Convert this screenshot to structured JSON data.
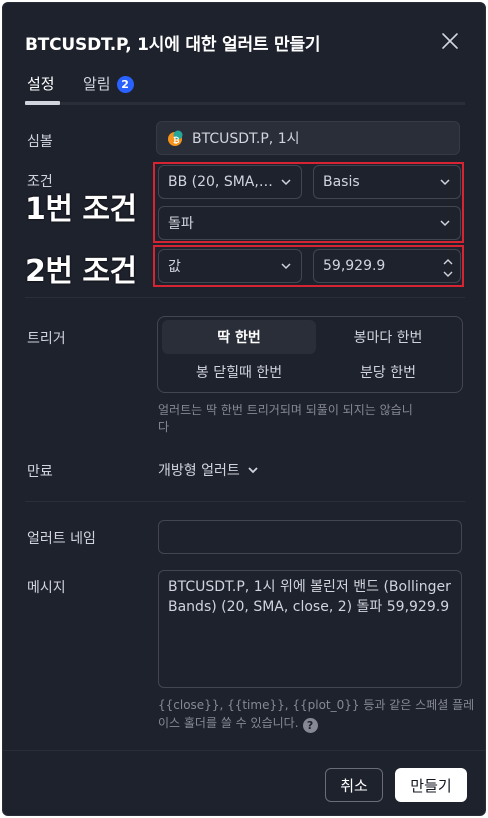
{
  "dialog": {
    "title": "BTCUSDT.P, 1시에 대한 얼러트 만들기"
  },
  "tabs": [
    {
      "label": "설정",
      "active": true
    },
    {
      "label": "알림",
      "badge": "2"
    }
  ],
  "symbol": {
    "label": "심볼",
    "value": "BTCUSDT.P, 1시"
  },
  "condition": {
    "label": "조건",
    "indicator": "BB (20, SMA, cl...",
    "line": "Basis",
    "operator": "돌파",
    "value_type": "값",
    "value": "59,929.9"
  },
  "overlays": {
    "condition1": "1번 조건",
    "condition2": "2번 조건"
  },
  "trigger": {
    "label": "트리거",
    "options": [
      "딱 한번",
      "봉마다 한번",
      "봉 닫힐때 한번",
      "분당 한번"
    ],
    "selected": "딱 한번",
    "help_line1": "얼러트는 딱 한번 트리거되며 되풀이 되지는 않습니",
    "help_line2": "다"
  },
  "expiration": {
    "label": "만료",
    "value": "개방형 얼러트"
  },
  "alert_name": {
    "label": "얼러트 네임",
    "value": ""
  },
  "message": {
    "label": "메시지",
    "value": "BTCUSDT.P, 1시 위에 볼린저 밴드 (Bollinger Bands) (20, SMA, close, 2) 돌파 59,929.9",
    "hint_line1": "{{close}}, {{time}}, {{plot_0}} 등과 같은 스페셜 플레",
    "hint_line2": "이스 홀더를 쓸 수 있습니다."
  },
  "footer": {
    "cancel": "취소",
    "create": "만들기"
  },
  "colors": {
    "background": "#1e222d",
    "border": "#434651",
    "accent": "#2962ff",
    "highlight_box": "#d62433"
  },
  "icons": {
    "close": "close-icon",
    "chevron": "chevron-down-icon",
    "coin": "btc-coin-icon",
    "spinner": "spinner-arrows-icon",
    "help": "question-icon"
  }
}
